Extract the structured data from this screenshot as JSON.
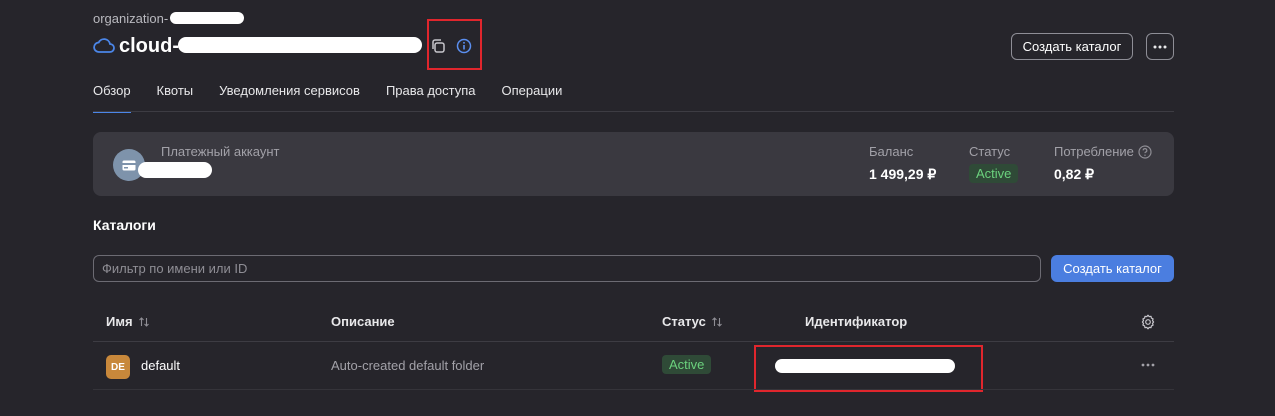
{
  "header": {
    "org_prefix": "organization-",
    "cloud_title": "cloud-"
  },
  "actions": {
    "create_catalog": "Создать каталог"
  },
  "tabs": [
    {
      "label": "Обзор",
      "active": true
    },
    {
      "label": "Квоты",
      "active": false
    },
    {
      "label": "Уведомления сервисов",
      "active": false
    },
    {
      "label": "Права доступа",
      "active": false
    },
    {
      "label": "Операции",
      "active": false
    }
  ],
  "billing": {
    "label": "Платежный аккаунт",
    "balance_label": "Баланс",
    "balance_value": "1 499,29 ₽",
    "status_label": "Статус",
    "status_value": "Active",
    "consumption_label": "Потребление",
    "consumption_value": "0,82 ₽"
  },
  "catalogs": {
    "title": "Каталоги",
    "filter_placeholder": "Фильтр по имени или ID",
    "create_label": "Создать каталог",
    "columns": {
      "name": "Имя",
      "description": "Описание",
      "status": "Статус",
      "id": "Идентификатор"
    },
    "rows": [
      {
        "badge": "DE",
        "name": "default",
        "description": "Auto-created default folder",
        "status": "Active"
      }
    ]
  },
  "colors": {
    "background": "#26252b",
    "panel": "#3a3940",
    "accent": "#4b7ee0",
    "active_status": "#6bd17d",
    "highlight_box": "#e0262d"
  }
}
